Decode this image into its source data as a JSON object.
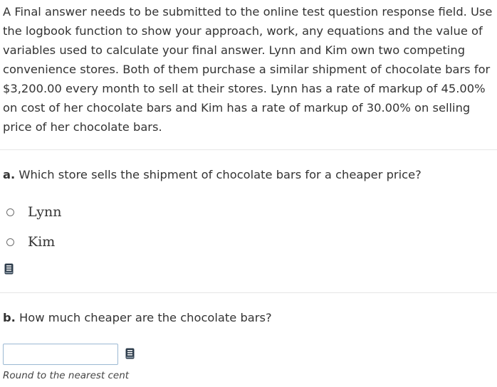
{
  "intro_text": "A Final answer needs to be submitted to the online test question response field. Use the logbook function to show your approach, work, any equations and the value of variables used to calculate your final answer. Lynn and Kim own two competing convenience stores. Both of them purchase a similar shipment of chocolate bars for $3,200.00 every month to sell at their stores. Lynn has a rate of markup of 45.00% on cost of her chocolate bars and Kim has a rate of markup of 30.00% on selling price of her chocolate bars.",
  "part_a": {
    "marker": "a.",
    "question": "Which store sells the shipment of chocolate bars for a cheaper price?",
    "options": [
      "Lynn",
      "Kim"
    ],
    "logbook_icon": "logbook-icon"
  },
  "part_b": {
    "marker": "b.",
    "question": "How much cheaper are the chocolate bars?",
    "answer_value": "",
    "logbook_icon": "logbook-icon",
    "hint": "Round to the nearest cent"
  },
  "colors": {
    "text": "#333333",
    "divider": "#e6e6e6",
    "input_border": "#9bb8d3",
    "logbook_icon": "#2f3e4d"
  }
}
